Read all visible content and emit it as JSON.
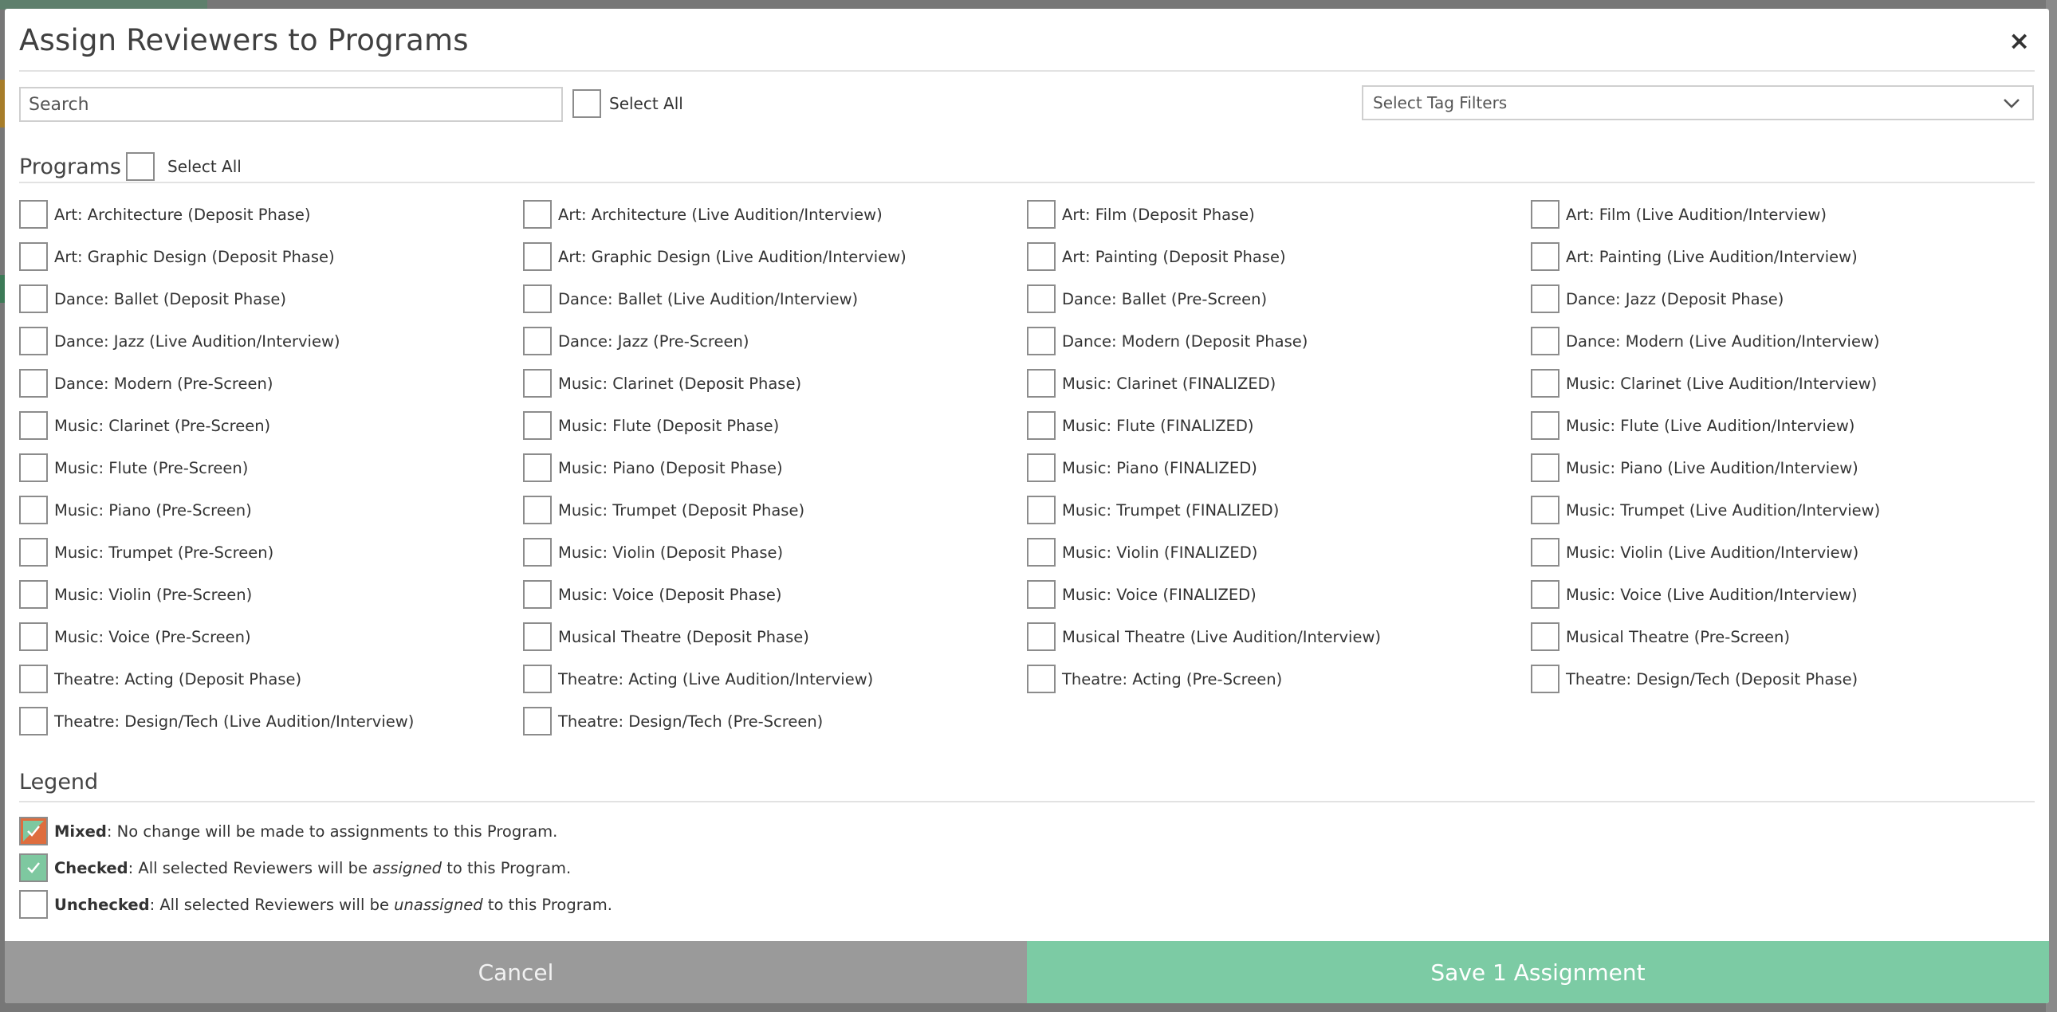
{
  "modal": {
    "title": "Assign Reviewers to Programs",
    "close_icon": "×"
  },
  "toolbar": {
    "search_placeholder": "Search",
    "select_all_label": "Select All",
    "tag_filter_label": "Select Tag Filters"
  },
  "programs": {
    "heading": "Programs",
    "select_all_label": "Select All",
    "items": [
      "Art: Architecture (Deposit Phase)",
      "Art: Architecture (Live Audition/Interview)",
      "Art: Film (Deposit Phase)",
      "Art: Film (Live Audition/Interview)",
      "Art: Graphic Design (Deposit Phase)",
      "Art: Graphic Design (Live Audition/Interview)",
      "Art: Painting (Deposit Phase)",
      "Art: Painting (Live Audition/Interview)",
      "Dance: Ballet (Deposit Phase)",
      "Dance: Ballet (Live Audition/Interview)",
      "Dance: Ballet (Pre-Screen)",
      "Dance: Jazz (Deposit Phase)",
      "Dance: Jazz (Live Audition/Interview)",
      "Dance: Jazz (Pre-Screen)",
      "Dance: Modern (Deposit Phase)",
      "Dance: Modern (Live Audition/Interview)",
      "Dance: Modern (Pre-Screen)",
      "Music: Clarinet (Deposit Phase)",
      "Music: Clarinet (FINALIZED)",
      "Music: Clarinet (Live Audition/Interview)",
      "Music: Clarinet (Pre-Screen)",
      "Music: Flute (Deposit Phase)",
      "Music: Flute (FINALIZED)",
      "Music: Flute (Live Audition/Interview)",
      "Music: Flute (Pre-Screen)",
      "Music: Piano (Deposit Phase)",
      "Music: Piano (FINALIZED)",
      "Music: Piano (Live Audition/Interview)",
      "Music: Piano (Pre-Screen)",
      "Music: Trumpet (Deposit Phase)",
      "Music: Trumpet (FINALIZED)",
      "Music: Trumpet (Live Audition/Interview)",
      "Music: Trumpet (Pre-Screen)",
      "Music: Violin (Deposit Phase)",
      "Music: Violin (FINALIZED)",
      "Music: Violin (Live Audition/Interview)",
      "Music: Violin (Pre-Screen)",
      "Music: Voice (Deposit Phase)",
      "Music: Voice (FINALIZED)",
      "Music: Voice (Live Audition/Interview)",
      "Music: Voice (Pre-Screen)",
      "Musical Theatre (Deposit Phase)",
      "Musical Theatre (Live Audition/Interview)",
      "Musical Theatre (Pre-Screen)",
      "Theatre: Acting (Deposit Phase)",
      "Theatre: Acting (Live Audition/Interview)",
      "Theatre: Acting (Pre-Screen)",
      "Theatre: Design/Tech (Deposit Phase)",
      "Theatre: Design/Tech (Live Audition/Interview)",
      "Theatre: Design/Tech (Pre-Screen)"
    ]
  },
  "legend": {
    "heading": "Legend",
    "mixed": {
      "term": "Mixed",
      "text": ": No change will be made to assignments to this Program."
    },
    "checked": {
      "term": "Checked",
      "pre": ": All selected Reviewers will be ",
      "em": "assigned",
      "post": " to this Program."
    },
    "unchecked": {
      "term": "Unchecked",
      "pre": ": All selected Reviewers will be ",
      "em": "unassigned",
      "post": " to this Program."
    }
  },
  "footer": {
    "cancel_label": "Cancel",
    "save_label": "Save 1 Assignment"
  },
  "colors": {
    "accent_green": "#7ccba4",
    "mixed_orange": "#de6d3e",
    "cancel_gray": "#9a9a9a"
  }
}
